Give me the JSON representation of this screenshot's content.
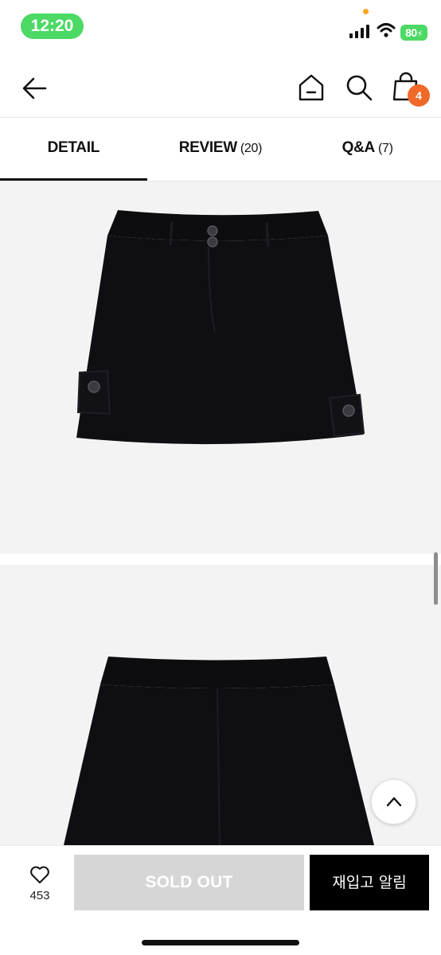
{
  "status_bar": {
    "time": "12:20",
    "battery": "80"
  },
  "nav": {
    "cart_count": "4"
  },
  "tabs": [
    {
      "label": "DETAIL",
      "count": ""
    },
    {
      "label": "REVIEW",
      "count": "(20)"
    },
    {
      "label": "Q&A",
      "count": "(7)"
    }
  ],
  "bottom_bar": {
    "like_count": "453",
    "soldout_label": "SOLD OUT",
    "restock_label": "재입고 알림"
  },
  "colors": {
    "status_green": "#4cd964",
    "badge_orange": "#ef6a2a",
    "soldout_gray": "#d6d6d6",
    "restock_black": "#000000"
  }
}
